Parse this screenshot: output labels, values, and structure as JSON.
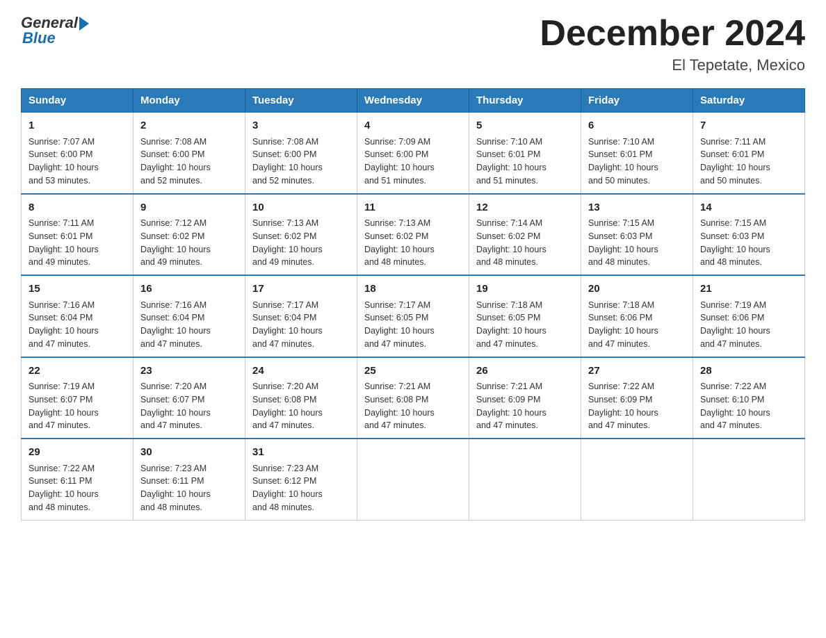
{
  "header": {
    "logo_general": "General",
    "logo_blue": "Blue",
    "title": "December 2024",
    "subtitle": "El Tepetate, Mexico"
  },
  "days_of_week": [
    "Sunday",
    "Monday",
    "Tuesday",
    "Wednesday",
    "Thursday",
    "Friday",
    "Saturday"
  ],
  "weeks": [
    [
      {
        "day": "1",
        "sunrise": "7:07 AM",
        "sunset": "6:00 PM",
        "daylight": "10 hours and 53 minutes."
      },
      {
        "day": "2",
        "sunrise": "7:08 AM",
        "sunset": "6:00 PM",
        "daylight": "10 hours and 52 minutes."
      },
      {
        "day": "3",
        "sunrise": "7:08 AM",
        "sunset": "6:00 PM",
        "daylight": "10 hours and 52 minutes."
      },
      {
        "day": "4",
        "sunrise": "7:09 AM",
        "sunset": "6:00 PM",
        "daylight": "10 hours and 51 minutes."
      },
      {
        "day": "5",
        "sunrise": "7:10 AM",
        "sunset": "6:01 PM",
        "daylight": "10 hours and 51 minutes."
      },
      {
        "day": "6",
        "sunrise": "7:10 AM",
        "sunset": "6:01 PM",
        "daylight": "10 hours and 50 minutes."
      },
      {
        "day": "7",
        "sunrise": "7:11 AM",
        "sunset": "6:01 PM",
        "daylight": "10 hours and 50 minutes."
      }
    ],
    [
      {
        "day": "8",
        "sunrise": "7:11 AM",
        "sunset": "6:01 PM",
        "daylight": "10 hours and 49 minutes."
      },
      {
        "day": "9",
        "sunrise": "7:12 AM",
        "sunset": "6:02 PM",
        "daylight": "10 hours and 49 minutes."
      },
      {
        "day": "10",
        "sunrise": "7:13 AM",
        "sunset": "6:02 PM",
        "daylight": "10 hours and 49 minutes."
      },
      {
        "day": "11",
        "sunrise": "7:13 AM",
        "sunset": "6:02 PM",
        "daylight": "10 hours and 48 minutes."
      },
      {
        "day": "12",
        "sunrise": "7:14 AM",
        "sunset": "6:02 PM",
        "daylight": "10 hours and 48 minutes."
      },
      {
        "day": "13",
        "sunrise": "7:15 AM",
        "sunset": "6:03 PM",
        "daylight": "10 hours and 48 minutes."
      },
      {
        "day": "14",
        "sunrise": "7:15 AM",
        "sunset": "6:03 PM",
        "daylight": "10 hours and 48 minutes."
      }
    ],
    [
      {
        "day": "15",
        "sunrise": "7:16 AM",
        "sunset": "6:04 PM",
        "daylight": "10 hours and 47 minutes."
      },
      {
        "day": "16",
        "sunrise": "7:16 AM",
        "sunset": "6:04 PM",
        "daylight": "10 hours and 47 minutes."
      },
      {
        "day": "17",
        "sunrise": "7:17 AM",
        "sunset": "6:04 PM",
        "daylight": "10 hours and 47 minutes."
      },
      {
        "day": "18",
        "sunrise": "7:17 AM",
        "sunset": "6:05 PM",
        "daylight": "10 hours and 47 minutes."
      },
      {
        "day": "19",
        "sunrise": "7:18 AM",
        "sunset": "6:05 PM",
        "daylight": "10 hours and 47 minutes."
      },
      {
        "day": "20",
        "sunrise": "7:18 AM",
        "sunset": "6:06 PM",
        "daylight": "10 hours and 47 minutes."
      },
      {
        "day": "21",
        "sunrise": "7:19 AM",
        "sunset": "6:06 PM",
        "daylight": "10 hours and 47 minutes."
      }
    ],
    [
      {
        "day": "22",
        "sunrise": "7:19 AM",
        "sunset": "6:07 PM",
        "daylight": "10 hours and 47 minutes."
      },
      {
        "day": "23",
        "sunrise": "7:20 AM",
        "sunset": "6:07 PM",
        "daylight": "10 hours and 47 minutes."
      },
      {
        "day": "24",
        "sunrise": "7:20 AM",
        "sunset": "6:08 PM",
        "daylight": "10 hours and 47 minutes."
      },
      {
        "day": "25",
        "sunrise": "7:21 AM",
        "sunset": "6:08 PM",
        "daylight": "10 hours and 47 minutes."
      },
      {
        "day": "26",
        "sunrise": "7:21 AM",
        "sunset": "6:09 PM",
        "daylight": "10 hours and 47 minutes."
      },
      {
        "day": "27",
        "sunrise": "7:22 AM",
        "sunset": "6:09 PM",
        "daylight": "10 hours and 47 minutes."
      },
      {
        "day": "28",
        "sunrise": "7:22 AM",
        "sunset": "6:10 PM",
        "daylight": "10 hours and 47 minutes."
      }
    ],
    [
      {
        "day": "29",
        "sunrise": "7:22 AM",
        "sunset": "6:11 PM",
        "daylight": "10 hours and 48 minutes."
      },
      {
        "day": "30",
        "sunrise": "7:23 AM",
        "sunset": "6:11 PM",
        "daylight": "10 hours and 48 minutes."
      },
      {
        "day": "31",
        "sunrise": "7:23 AM",
        "sunset": "6:12 PM",
        "daylight": "10 hours and 48 minutes."
      },
      null,
      null,
      null,
      null
    ]
  ],
  "labels": {
    "sunrise": "Sunrise:",
    "sunset": "Sunset:",
    "daylight": "Daylight:"
  }
}
